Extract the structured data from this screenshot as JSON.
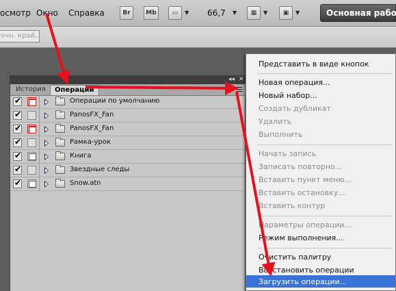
{
  "menubar": {
    "items": [
      "осмотр",
      "Окно",
      "Справка"
    ],
    "br_label": "Br",
    "mb_label": "Mb",
    "zoom": "66,7",
    "workspace": "Основная рабоча"
  },
  "options": {
    "edge_field": "очн. край..."
  },
  "panel": {
    "tabs": [
      "История",
      "Операции"
    ],
    "actions": [
      {
        "label": "Операции по умолчанию",
        "checked": true,
        "dialog": "red"
      },
      {
        "label": "PanosFX_Fan",
        "checked": true,
        "dialog": "off"
      },
      {
        "label": "PanosFX_Fan",
        "checked": true,
        "dialog": "red"
      },
      {
        "label": "Рамка-урок",
        "checked": true,
        "dialog": "off"
      },
      {
        "label": "Книга",
        "checked": true,
        "dialog": "on"
      },
      {
        "label": "Звездные следы",
        "checked": true,
        "dialog": "off"
      },
      {
        "label": "Snow.atn",
        "checked": true,
        "dialog": "on"
      }
    ]
  },
  "dropdown": {
    "items": [
      {
        "label": "Представить в виде кнопок",
        "disabled": false
      },
      {
        "label": "Новая операция...",
        "disabled": false
      },
      {
        "label": "Новый набор...",
        "disabled": false
      },
      {
        "label": "Создать дубликат",
        "disabled": true
      },
      {
        "label": "Удалить",
        "disabled": true
      },
      {
        "label": "Выполнить",
        "disabled": true
      },
      {
        "label": "Начать запись",
        "disabled": true
      },
      {
        "label": "Записать повторно...",
        "disabled": true
      },
      {
        "label": "Вставить пункт меню...",
        "disabled": true
      },
      {
        "label": "Вставить остановку...",
        "disabled": true
      },
      {
        "label": "Вставить контур",
        "disabled": true
      },
      {
        "label": "Параметры операции...",
        "disabled": true
      },
      {
        "label": "Режим выполнения...",
        "disabled": false
      },
      {
        "label": "Очистить палитру",
        "disabled": false
      },
      {
        "label": "Восстановить операции",
        "disabled": false
      },
      {
        "label": "Загрузить операции...",
        "disabled": false,
        "highlighted": true
      }
    ]
  },
  "annotation_color": "#e8101a",
  "highlight_color": "#3a73d6"
}
